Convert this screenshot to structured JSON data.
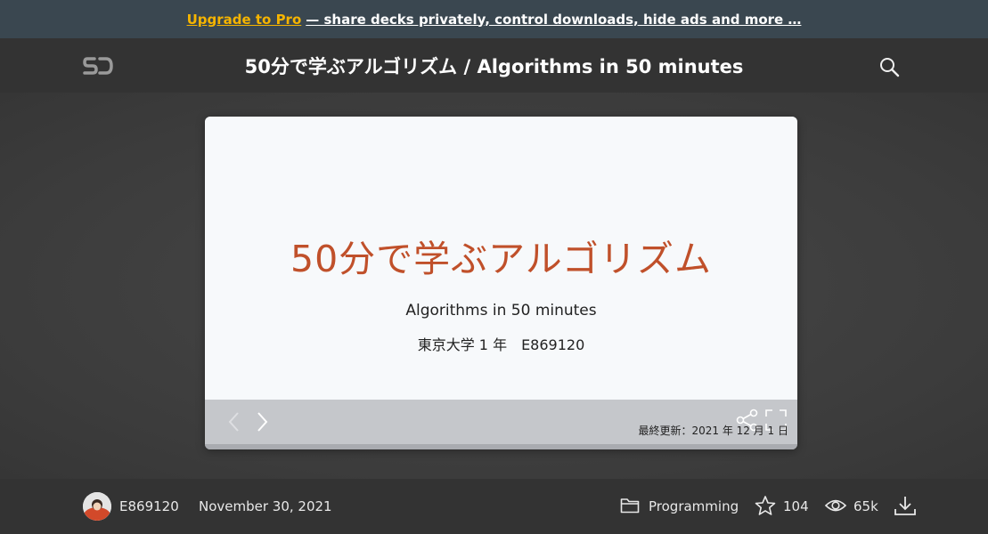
{
  "promo": {
    "link_label": "Upgrade to Pro",
    "text": "— share decks privately, control downloads, hide ads and more …"
  },
  "header": {
    "title": "50分で学ぶアルゴリズム / Algorithms in 50 minutes",
    "logo_icon": "speakerdeck-logo-icon",
    "search_icon": "search-icon"
  },
  "slide": {
    "title": "50分で学ぶアルゴリズム",
    "subtitle": "Algorithms in 50 minutes",
    "author_line": "東京大学 1 年　E869120",
    "updated": "最終更新：2021 年 12 月 1 日",
    "colors": {
      "title": "#c0502a",
      "background": "#f7f9fb"
    }
  },
  "footer": {
    "user": "E869120",
    "date": "November 30, 2021",
    "category": "Programming",
    "stars": "104",
    "views": "65k"
  },
  "colors": {
    "promo_bg": "#3a4750",
    "promo_link": "#f5b400",
    "header_bg": "#333333"
  }
}
